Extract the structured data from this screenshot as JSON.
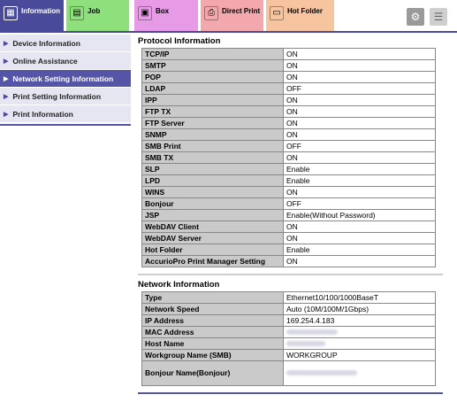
{
  "tabs": [
    {
      "label": "Information",
      "icon": "information-icon"
    },
    {
      "label": "Job",
      "icon": "job-icon"
    },
    {
      "label": "Box",
      "icon": "box-icon"
    },
    {
      "label": "Direct Print",
      "icon": "direct-print-icon"
    },
    {
      "label": "Hot Folder",
      "icon": "hot-folder-icon"
    }
  ],
  "sidebar": {
    "items": [
      {
        "label": "Device Information"
      },
      {
        "label": "Online Assistance"
      },
      {
        "label": "Network Setting Information",
        "active": true
      },
      {
        "label": "Print Setting Information"
      },
      {
        "label": "Print Information"
      }
    ]
  },
  "protocol": {
    "title": "Protocol Information",
    "rows": [
      {
        "key": "TCP/IP",
        "value": "ON"
      },
      {
        "key": "SMTP",
        "value": "ON"
      },
      {
        "key": "POP",
        "value": "ON"
      },
      {
        "key": "LDAP",
        "value": "OFF"
      },
      {
        "key": "IPP",
        "value": "ON"
      },
      {
        "key": "FTP TX",
        "value": "ON"
      },
      {
        "key": "FTP Server",
        "value": "ON"
      },
      {
        "key": "SNMP",
        "value": "ON"
      },
      {
        "key": "SMB Print",
        "value": "OFF"
      },
      {
        "key": "SMB TX",
        "value": "ON"
      },
      {
        "key": "SLP",
        "value": "Enable"
      },
      {
        "key": "LPD",
        "value": "Enable"
      },
      {
        "key": "WINS",
        "value": "ON"
      },
      {
        "key": "Bonjour",
        "value": "OFF"
      },
      {
        "key": "JSP",
        "value": "Enable(Without Password)"
      },
      {
        "key": "WebDAV Client",
        "value": "ON"
      },
      {
        "key": "WebDAV Server",
        "value": "ON"
      },
      {
        "key": "Hot Folder",
        "value": "Enable"
      },
      {
        "key": "AccurioPro Print Manager Setting",
        "value": "ON"
      }
    ]
  },
  "network": {
    "title": "Network Information",
    "rows": [
      {
        "key": "Type",
        "value": "Ethernet10/100/1000BaseT"
      },
      {
        "key": "Network Speed",
        "value": "Auto (10M/100M/1Gbps)"
      },
      {
        "key": "IP Address",
        "value": "169.254.4.183"
      },
      {
        "key": "MAC Address",
        "value": "",
        "blurred": true
      },
      {
        "key": "Host Name",
        "value": "",
        "blurred": true
      },
      {
        "key": "Workgroup Name (SMB)",
        "value": "WORKGROUP"
      },
      {
        "key": "Bonjour Name(Bonjour)",
        "value": "",
        "blurred": true,
        "tall": true
      }
    ]
  }
}
